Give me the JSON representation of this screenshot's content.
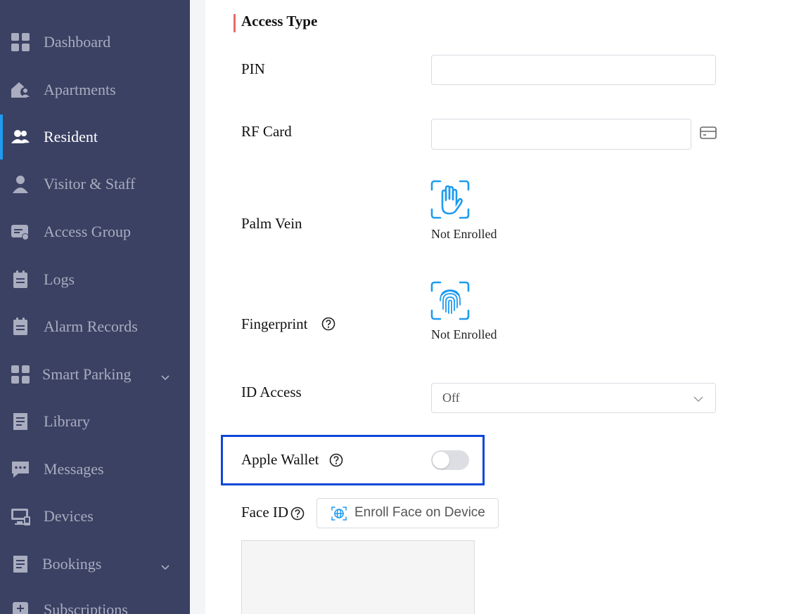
{
  "sidebar": {
    "items": [
      {
        "label": "Dashboard",
        "icon": "dashboard-icon"
      },
      {
        "label": "Apartments",
        "icon": "apartments-icon"
      },
      {
        "label": "Resident",
        "icon": "resident-icon",
        "active": true
      },
      {
        "label": "Visitor & Staff",
        "icon": "visitor-icon"
      },
      {
        "label": "Access Group",
        "icon": "access-group-icon"
      },
      {
        "label": "Logs",
        "icon": "logs-icon"
      },
      {
        "label": "Alarm Records",
        "icon": "alarm-records-icon"
      },
      {
        "label": "Smart Parking",
        "icon": "smart-parking-icon",
        "expandable": true
      },
      {
        "label": "Library",
        "icon": "library-icon"
      },
      {
        "label": "Messages",
        "icon": "messages-icon"
      },
      {
        "label": "Devices",
        "icon": "devices-icon"
      },
      {
        "label": "Bookings",
        "icon": "bookings-icon",
        "expandable": true
      },
      {
        "label": "Subscriptions",
        "icon": "subscriptions-icon"
      }
    ]
  },
  "form": {
    "section_title": "Access Type",
    "pin": {
      "label": "PIN",
      "value": ""
    },
    "rf_card": {
      "label": "RF Card",
      "value": ""
    },
    "palm_vein": {
      "label": "Palm Vein",
      "status": "Not Enrolled"
    },
    "fingerprint": {
      "label": "Fingerprint",
      "status": "Not Enrolled"
    },
    "id_access": {
      "label": "ID Access",
      "value": "Off"
    },
    "apple_wallet": {
      "label": "Apple Wallet",
      "enabled": false
    },
    "face_id": {
      "label": "Face ID",
      "button_label": "Enroll Face on Device"
    }
  },
  "colors": {
    "sidebar_bg": "#3b4163",
    "accent": "#1e9bf0",
    "section_marker": "#e86a6a",
    "highlight_border": "#0d47d6"
  }
}
